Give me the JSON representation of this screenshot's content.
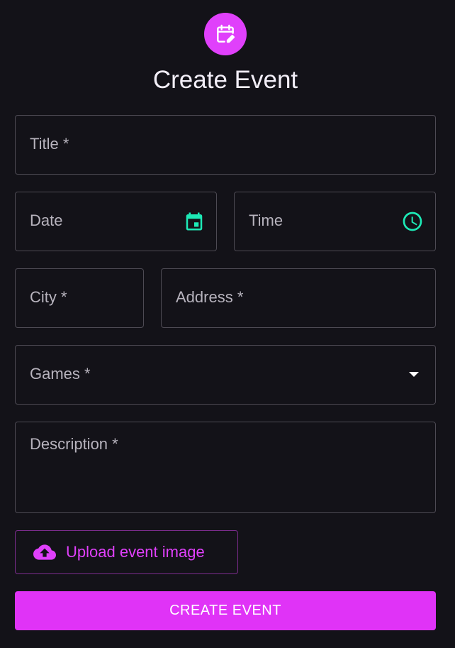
{
  "header": {
    "title": "Create Event",
    "icon": "calendar-edit-icon"
  },
  "form": {
    "title_label": "Title *",
    "date_label": "Date",
    "time_label": "Time",
    "city_label": "City *",
    "address_label": "Address *",
    "games_label": "Games *",
    "description_label": "Description *"
  },
  "upload": {
    "label": "Upload event image",
    "icon": "cloud-upload-icon"
  },
  "submit": {
    "label": "CREATE EVENT"
  },
  "colors": {
    "accent": "#e040fb",
    "icon_teal": "#1de9b6",
    "background": "#131218",
    "border": "#4d4a53"
  }
}
